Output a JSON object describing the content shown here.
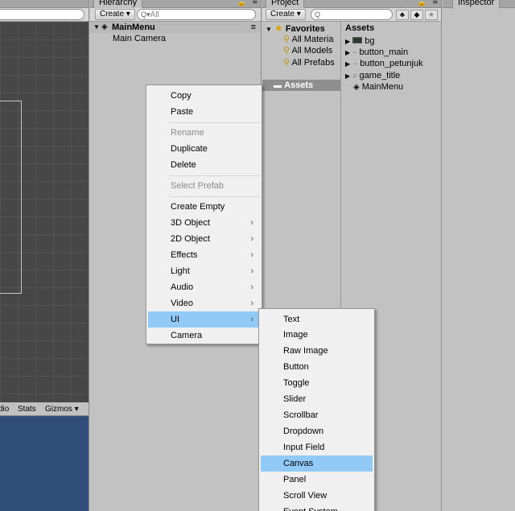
{
  "scene": {
    "tab_label": ""
  },
  "game_bar": {
    "items": [
      "dio",
      "Stats",
      "Gizmos ▾"
    ]
  },
  "hierarchy": {
    "tab_label": "Hierarchy",
    "create_label": "Create ▾",
    "search_placeholder": "All",
    "scene_name": "MainMenu",
    "objects": [
      "Main Camera"
    ]
  },
  "project": {
    "tab_label": "Project",
    "create_label": "Create ▾",
    "favorites_label": "Favorites",
    "favorites": [
      "All Materia",
      "All Models",
      "All Prefabs"
    ],
    "assets_folder": "Assets",
    "assets_header": "Assets",
    "assets": [
      "bg",
      "button_main",
      "button_petunjuk",
      "game_title",
      "MainMenu"
    ]
  },
  "inspector": {
    "tab_label": "Inspector"
  },
  "context_menu": {
    "items": [
      "Copy",
      "Paste",
      "Rename",
      "Duplicate",
      "Delete",
      "Select Prefab",
      "Create Empty",
      "3D Object",
      "2D Object",
      "Effects",
      "Light",
      "Audio",
      "Video",
      "UI",
      "Camera"
    ]
  },
  "ui_submenu": {
    "items": [
      "Text",
      "Image",
      "Raw Image",
      "Button",
      "Toggle",
      "Slider",
      "Scrollbar",
      "Dropdown",
      "Input Field",
      "Canvas",
      "Panel",
      "Scroll View",
      "Event System"
    ]
  },
  "colors": {
    "highlight": "#91c9f7",
    "scene_bg": "#474747",
    "game_bg": "#314d79",
    "menu_bg": "#f0f0f0"
  }
}
